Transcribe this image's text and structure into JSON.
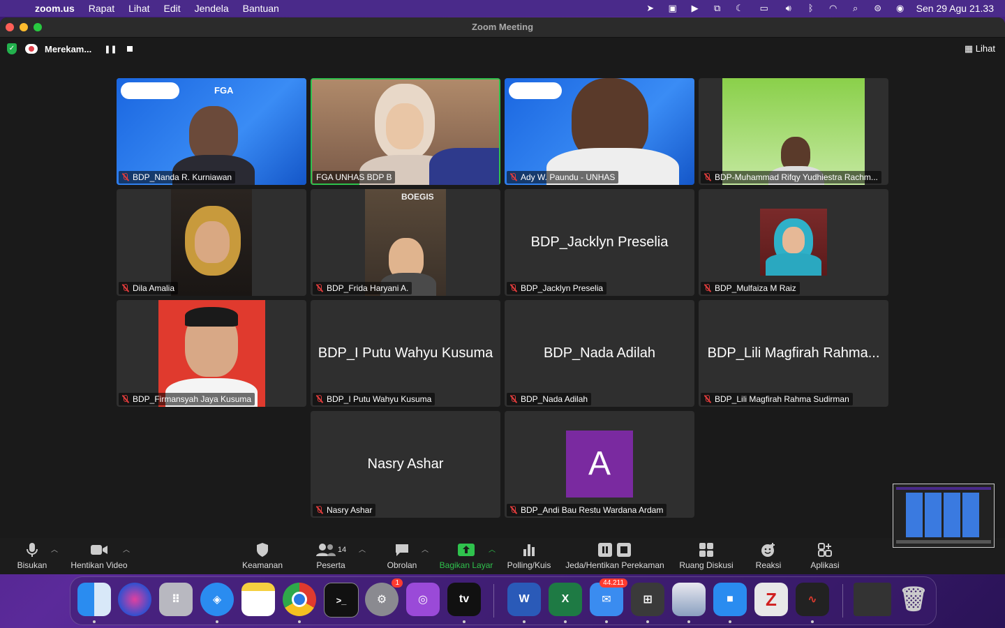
{
  "menubar": {
    "app": "zoom.us",
    "items": [
      "Rapat",
      "Lihat",
      "Edit",
      "Jendela",
      "Bantuan"
    ],
    "datetime": "Sen 29 Agu  21.33"
  },
  "window": {
    "title": "Zoom Meeting",
    "recording_label": "Merekam...",
    "view_label": "Lihat"
  },
  "tiles": [
    {
      "label": "BDP_Nanda R. Kurniawan",
      "muted": true,
      "video": true
    },
    {
      "label": "FGA UNHAS BDP B",
      "muted": false,
      "video": true,
      "active": true
    },
    {
      "label": "Ady W. Paundu - UNHAS",
      "muted": true,
      "video": true
    },
    {
      "label": "BDP-Muhammad Rifqy Yudhiestra Rachm...",
      "muted": true,
      "video": true
    },
    {
      "label": "Dila Amalia",
      "muted": true,
      "video": true
    },
    {
      "label": "BDP_Frida Haryani A.",
      "muted": true,
      "video": true
    },
    {
      "label": "BDP_Jacklyn Preselia",
      "big_name": "BDP_Jacklyn Preselia",
      "muted": true,
      "video": false
    },
    {
      "label": "BDP_Mulfaiza M Raiz",
      "muted": true,
      "video": true
    },
    {
      "label": "BDP_Firmansyah Jaya Kusuma",
      "muted": true,
      "video": true
    },
    {
      "label": "BDP_I Putu Wahyu Kusuma",
      "big_name": "BDP_I Putu Wahyu Kusuma",
      "muted": true,
      "video": false
    },
    {
      "label": "BDP_Nada Adilah",
      "big_name": "BDP_Nada Adilah",
      "muted": true,
      "video": false
    },
    {
      "label": "BDP_Lili Magfirah Rahma Sudirman",
      "big_name": "BDP_Lili Magfirah Rahma...",
      "muted": true,
      "video": false
    },
    {
      "label": "Nasry Ashar",
      "big_name": "Nasry Ashar",
      "muted": true,
      "video": false
    },
    {
      "label": "BDP_Andi Bau Restu Wardana Ardam",
      "avatar_letter": "A",
      "muted": true,
      "video": false
    }
  ],
  "toolbar": {
    "mute": "Bisukan",
    "video": "Hentikan Video",
    "security": "Keamanan",
    "participants": "Peserta",
    "participants_count": "14",
    "chat": "Obrolan",
    "share": "Bagikan Layar",
    "polling": "Polling/Kuis",
    "record": "Jeda/Hentikan Perekaman",
    "breakout": "Ruang Diskusi",
    "reactions": "Reaksi",
    "apps": "Aplikasi"
  },
  "dock": {
    "settings_badge": "1",
    "mail_badge": "44.211",
    "appletv_label": "tv"
  },
  "colors": {
    "accent_green": "#2fc24d",
    "mute_red": "#e03c3c",
    "avatar_purple": "#7a2aa0"
  }
}
